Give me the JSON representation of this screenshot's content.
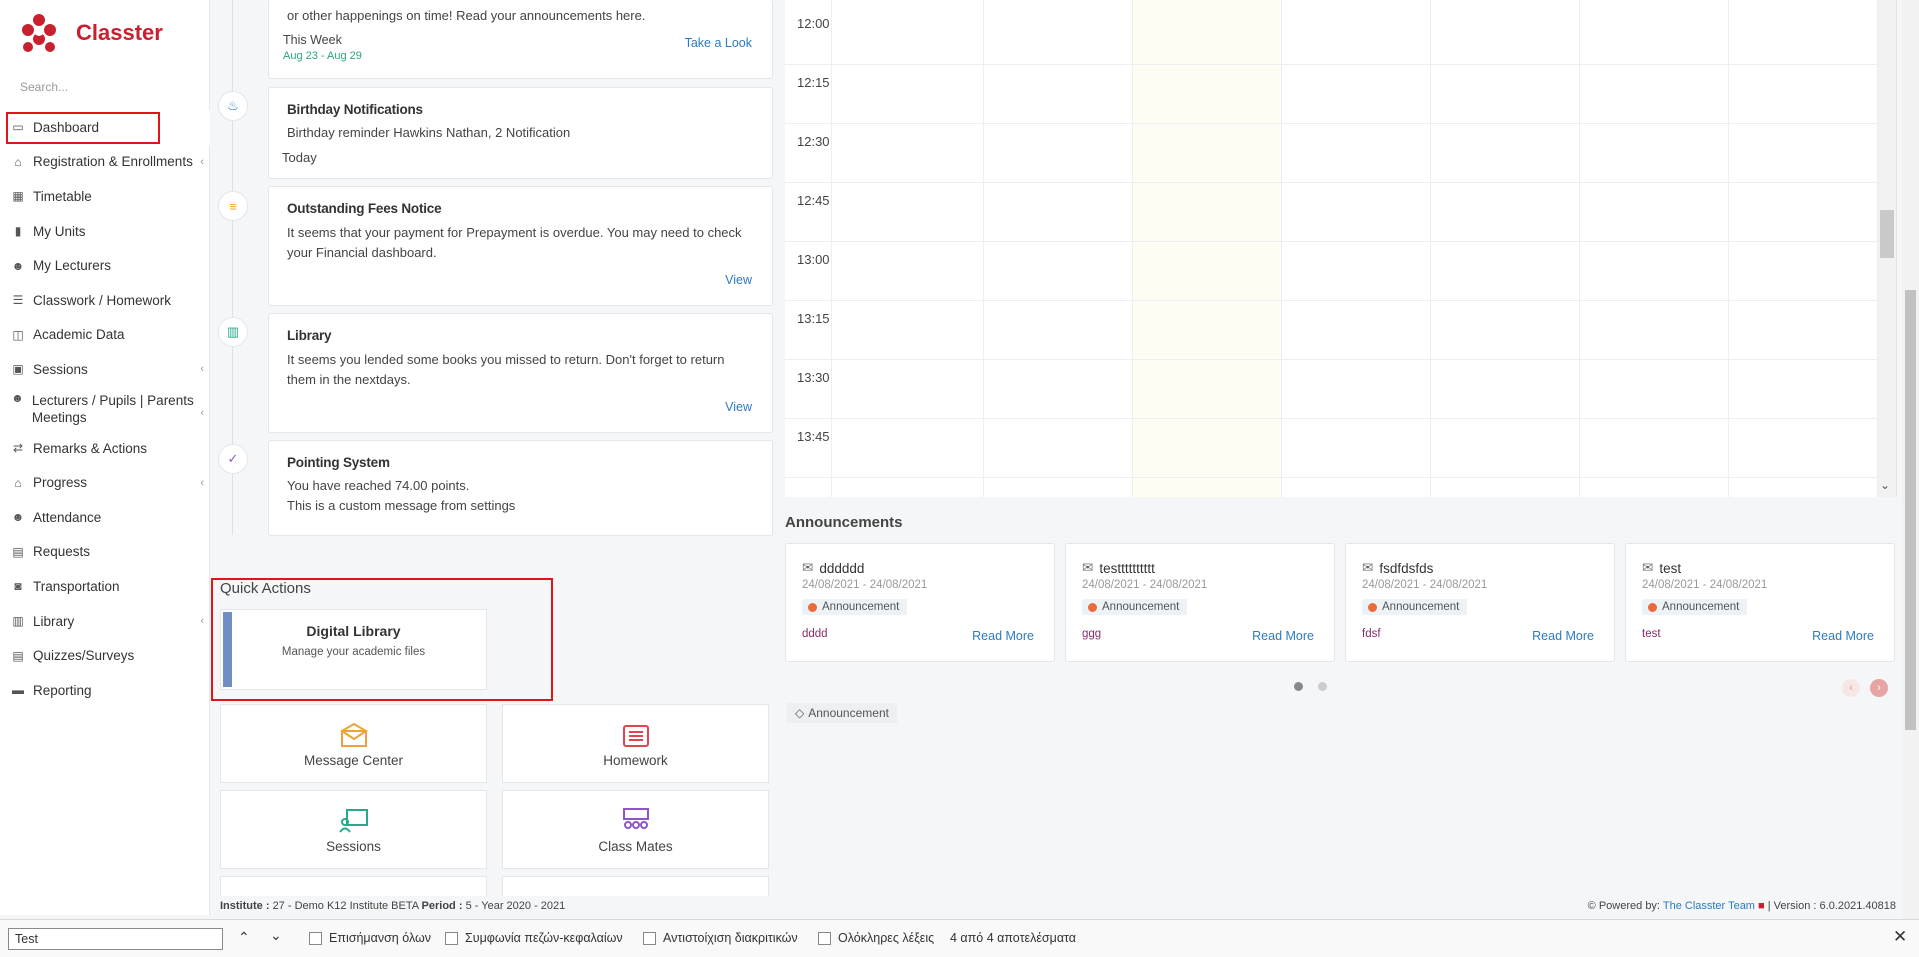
{
  "app": {
    "name": "Classter",
    "search_placeholder": "Search..."
  },
  "sidebar": {
    "items": [
      {
        "label": "Dashboard",
        "icon": "laptop-icon",
        "chevron": false
      },
      {
        "label": "Registration & Enrollments",
        "icon": "bank-icon",
        "chevron": true
      },
      {
        "label": "Timetable",
        "icon": "calendar-icon",
        "chevron": false
      },
      {
        "label": "My Units",
        "icon": "book-icon",
        "chevron": false
      },
      {
        "label": "My Lecturers",
        "icon": "users-icon",
        "chevron": false
      },
      {
        "label": "Classwork / Homework",
        "icon": "list-icon",
        "chevron": false
      },
      {
        "label": "Academic Data",
        "icon": "chart-icon",
        "chevron": false
      },
      {
        "label": "Sessions",
        "icon": "presentation-icon",
        "chevron": true
      },
      {
        "label": "Lecturers / Pupils | Parents Meetings",
        "icon": "meeting-icon",
        "chevron": true
      },
      {
        "label": "Remarks & Actions",
        "icon": "shuffle-icon",
        "chevron": false
      },
      {
        "label": "Progress",
        "icon": "graduation-cap-icon",
        "chevron": true
      },
      {
        "label": "Attendance",
        "icon": "user-x-icon",
        "chevron": false
      },
      {
        "label": "Requests",
        "icon": "document-icon",
        "chevron": false
      },
      {
        "label": "Transportation",
        "icon": "bus-icon",
        "chevron": false
      },
      {
        "label": "Library",
        "icon": "books-icon",
        "chevron": true
      },
      {
        "label": "Quizzes/Surveys",
        "icon": "clipboard-icon",
        "chevron": false
      },
      {
        "label": "Reporting",
        "icon": "printer-icon",
        "chevron": false
      }
    ]
  },
  "timeline": {
    "top_card": {
      "text": "or other happenings on time! Read your announcements here.",
      "period": "This Week",
      "range": "Aug 23 - Aug 29",
      "link": "Take a Look"
    },
    "birthday": {
      "title": "Birthday Notifications",
      "text": "Birthday reminder Hawkins Nathan, 2 Notification",
      "when": "Today"
    },
    "fees": {
      "title": "Outstanding Fees Notice",
      "text": "It seems that your payment for Prepayment is overdue. You may need to check your Financial dashboard.",
      "link": "View"
    },
    "library": {
      "title": "Library",
      "text": "It seems you lended some books you missed to return. Don't forget to return them in the nextdays.",
      "link": "View"
    },
    "points": {
      "title": "Pointing System",
      "text1": "You have reached 74.00 points.",
      "text2": "This is a custom message from settings"
    }
  },
  "quick_actions": {
    "title": "Quick Actions",
    "digital_library": {
      "title": "Digital Library",
      "subtitle": "Manage your academic files"
    },
    "items": [
      {
        "label": "Message Center",
        "icon": "envelope-icon",
        "color": "#f0a23a"
      },
      {
        "label": "Homework",
        "icon": "list-icon",
        "color": "#e2444f"
      },
      {
        "label": "Sessions",
        "icon": "presentation-icon",
        "color": "#27a98a"
      },
      {
        "label": "Class Mates",
        "icon": "classroom-icon",
        "color": "#8c55c9"
      }
    ]
  },
  "calendar": {
    "times": [
      "12:00",
      "12:15",
      "12:30",
      "12:45",
      "13:00",
      "13:15",
      "13:30",
      "13:45"
    ]
  },
  "announcements": {
    "title": "Announcements",
    "cards": [
      {
        "name": "dddddd",
        "dates": "24/08/2021 - 24/08/2021",
        "tag": "Announcement",
        "body": "dddd",
        "more": "Read More"
      },
      {
        "name": "testttttttttt",
        "dates": "24/08/2021 - 24/08/2021",
        "tag": "Announcement",
        "body": "ggg",
        "more": "Read More"
      },
      {
        "name": "fsdfdsfds",
        "dates": "24/08/2021 - 24/08/2021",
        "tag": "Announcement",
        "body": "fdsf",
        "more": "Read More"
      },
      {
        "name": "test",
        "dates": "24/08/2021 - 24/08/2021",
        "tag": "Announcement",
        "body": "test",
        "more": "Read More"
      }
    ],
    "filter_tag": "Announcement"
  },
  "footer": {
    "institute_label": "Institute :",
    "institute": "27 - Demo K12 Institute BETA",
    "period_label": "Period :",
    "period": "5 - Year 2020 - 2021",
    "powered_by": "Powered by:",
    "team": "The Classter Team",
    "version": "| Version : 6.0.2021.40818"
  },
  "find_bar": {
    "query": "Test",
    "options": [
      "Επισήμανση όλων",
      "Συμφωνία πεζών-κεφαλαίων",
      "Αντιστοίχιση διακριτικών",
      "Ολόκληρες λέξεις"
    ],
    "result": "4 από 4 αποτελέσματα"
  },
  "colors": {
    "brand": "#c8202f",
    "link": "#2c7bbf",
    "highlight": "#e0141b",
    "accent_bar": "#6f8fc4"
  }
}
